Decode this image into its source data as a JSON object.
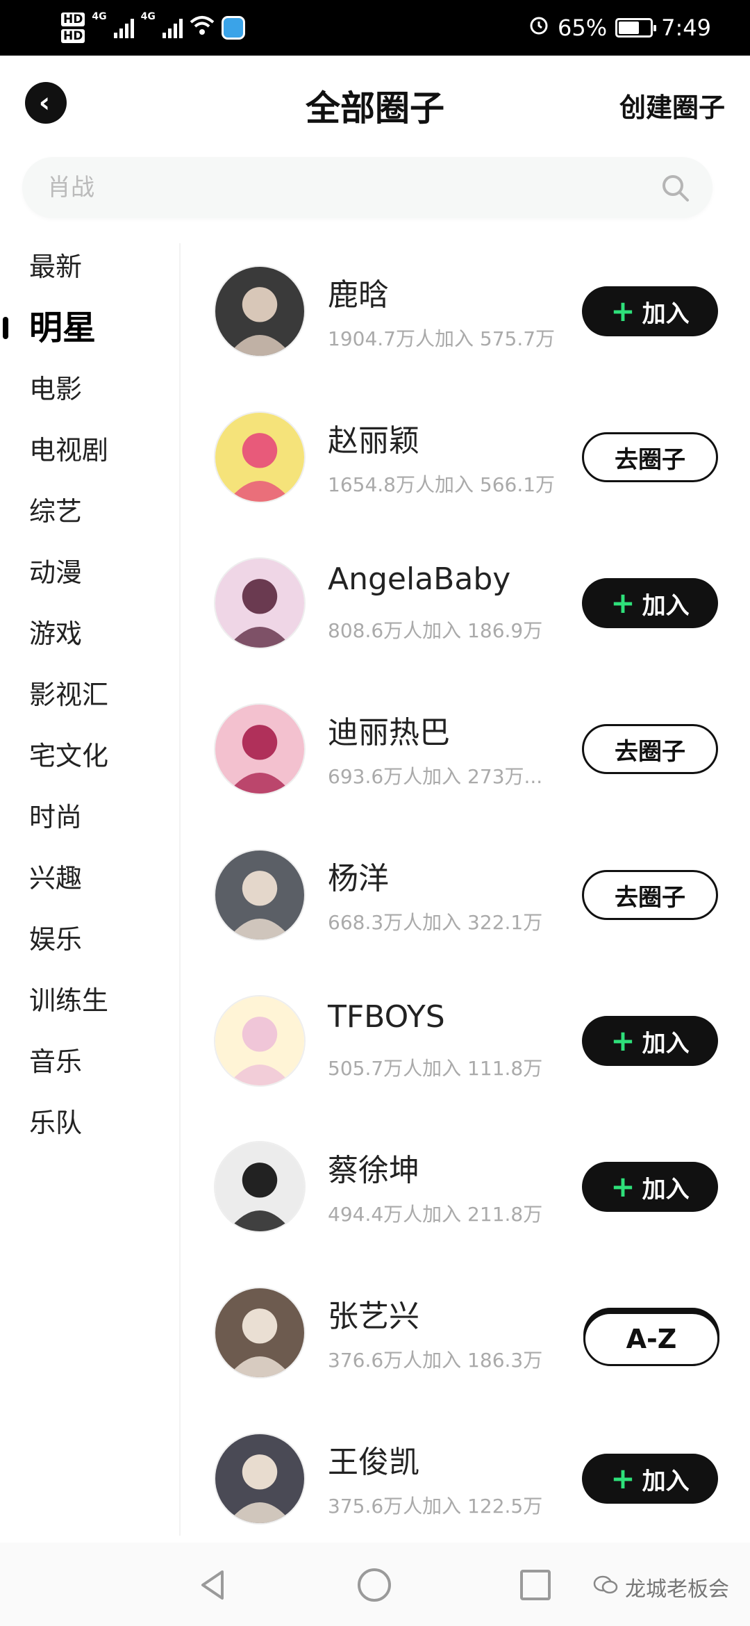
{
  "status_bar": {
    "hd1": "HD",
    "hd2": "HD",
    "net1": "4G",
    "net2": "4G",
    "battery_pct": "65%",
    "battery_level": 0.65,
    "time": "7:49"
  },
  "header": {
    "title": "全部圈子",
    "create_label": "创建圈子"
  },
  "search": {
    "placeholder": "肖战"
  },
  "sidebar": {
    "categories": [
      "最新",
      "明星",
      "电影",
      "电视剧",
      "综艺",
      "动漫",
      "游戏",
      "影视汇",
      "宅文化",
      "时尚",
      "兴趣",
      "娱乐",
      "训练生",
      "音乐",
      "乐队"
    ],
    "active_index": 1
  },
  "buttons": {
    "join_label": "加入",
    "join_icon": "+",
    "goto_label": "去圈子"
  },
  "circles": [
    {
      "name": "鹿晗",
      "stats": "1904.7万人加入  575.7万",
      "action": "join"
    },
    {
      "name": "赵丽颖",
      "stats": "1654.8万人加入  566.1万",
      "action": "goto"
    },
    {
      "name": "AngelaBaby",
      "stats": "808.6万人加入  186.9万",
      "action": "join"
    },
    {
      "name": "迪丽热巴",
      "stats": "693.6万人加入  273万...",
      "action": "goto"
    },
    {
      "name": "杨洋",
      "stats": "668.3万人加入  322.1万",
      "action": "goto"
    },
    {
      "name": "TFBOYS",
      "stats": "505.7万人加入  111.8万",
      "action": "join"
    },
    {
      "name": "蔡徐坤",
      "stats": "494.4万人加入  211.8万",
      "action": "join"
    },
    {
      "name": "张艺兴",
      "stats": "376.6万人加入  186.3万",
      "action": "join"
    },
    {
      "name": "王俊凯",
      "stats": "375.6万人加入  122.5万",
      "action": "join"
    }
  ],
  "az_label": "A-Z",
  "watermark": "龙城老板会",
  "colors": {
    "accent_green": "#2ee07a",
    "button_dark": "#111111"
  }
}
